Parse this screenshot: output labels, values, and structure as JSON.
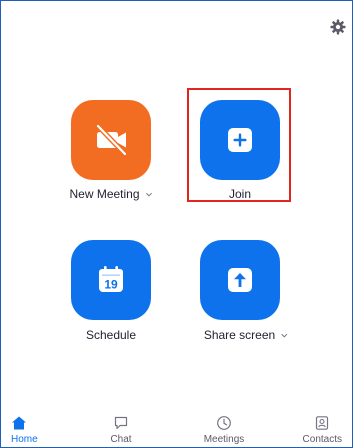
{
  "tiles": {
    "new_meeting": {
      "label": "New Meeting",
      "icon": "video-off-icon",
      "color": "#f26d21"
    },
    "join": {
      "label": "Join",
      "icon": "plus-icon",
      "color": "#0e72ed"
    },
    "schedule": {
      "label": "Schedule",
      "icon": "calendar-icon",
      "calendar_day": "19",
      "color": "#0e72ed"
    },
    "share_screen": {
      "label": "Share screen",
      "icon": "share-up-arrow-icon",
      "color": "#0e72ed"
    }
  },
  "highlight_color": "#e0261e",
  "nav": {
    "items": [
      {
        "label": "Home",
        "icon": "home-icon",
        "active": true
      },
      {
        "label": "Chat",
        "icon": "chat-icon",
        "active": false
      },
      {
        "label": "Meetings",
        "icon": "clock-icon",
        "active": false
      },
      {
        "label": "Contacts",
        "icon": "contacts-icon",
        "active": false
      }
    ],
    "active_color": "#0e72ed"
  }
}
